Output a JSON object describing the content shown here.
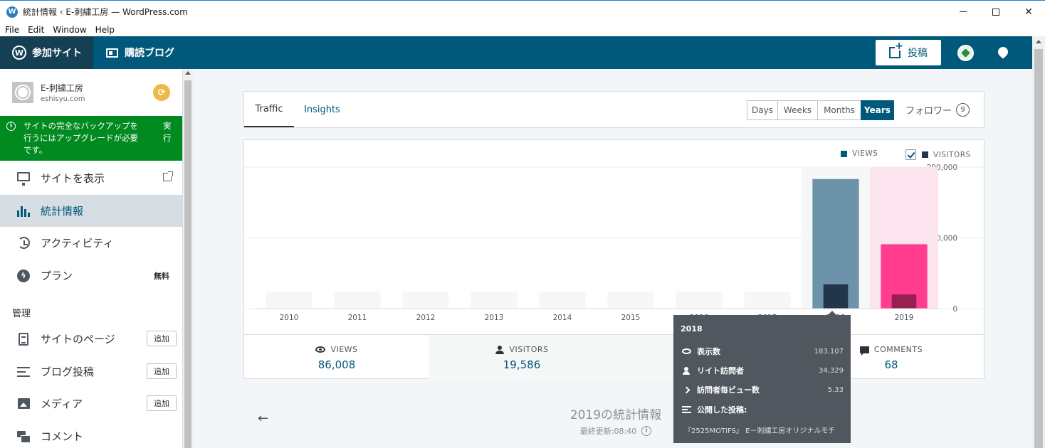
{
  "window": {
    "title": "統計情報 ‹ E-刺繍工房 — WordPress.com",
    "app_icon": "W"
  },
  "menubar": [
    "File",
    "Edit",
    "Window",
    "Help"
  ],
  "masterbar": {
    "my_sites": "参加サイト",
    "reader": "購読ブログ",
    "write": "投稿",
    "colors": {
      "bar": "#00587a",
      "active": "#154054"
    }
  },
  "site": {
    "name": "E-刺繍工房",
    "url": "eshisyu.com"
  },
  "notice": {
    "message": "サイトの完全なバックアップを行うにはアップグレードが必要です。",
    "action": "実行"
  },
  "sidebar": {
    "items": [
      {
        "label": "サイトを表示",
        "icon": "monitor-icon"
      },
      {
        "label": "統計情報",
        "icon": "stats-icon",
        "active": true
      },
      {
        "label": "アクティビティ",
        "icon": "history-icon"
      },
      {
        "label": "プラン",
        "icon": "plan-icon",
        "badge": "無料"
      }
    ],
    "group_heading": "管理",
    "manage_items": [
      {
        "label": "サイトのページ",
        "icon": "page-icon",
        "action": "追加"
      },
      {
        "label": "ブログ投稿",
        "icon": "posts-icon",
        "action": "追加"
      },
      {
        "label": "メディア",
        "icon": "media-icon",
        "action": "追加"
      },
      {
        "label": "コメント",
        "icon": "comment-icon"
      }
    ]
  },
  "stats": {
    "tabs": [
      "Traffic",
      "Insights"
    ],
    "periods": [
      "Days",
      "Weeks",
      "Months",
      "Years"
    ],
    "active_period": "Years",
    "followers_label": "フォロワー",
    "followers_count": "9",
    "legend": {
      "views": "VIEWS",
      "visitors": "VISITORS"
    },
    "summary": [
      {
        "label": "VIEWS",
        "value": "86,008",
        "icon": "eye-icon"
      },
      {
        "label": "VISITORS",
        "value": "19,586",
        "icon": "person-icon"
      },
      {
        "label": "COMMENTS",
        "value": "68",
        "icon": "comment-icon"
      }
    ],
    "period_title": "2019の統計情報",
    "last_updated": "最終更新:08:40"
  },
  "chart_data": {
    "type": "bar",
    "categories": [
      "2010",
      "2011",
      "2012",
      "2013",
      "2014",
      "2015",
      "2016",
      "2017",
      "2018",
      "2019"
    ],
    "series": [
      {
        "name": "VIEWS",
        "values": [
          0,
          0,
          0,
          0,
          0,
          0,
          0,
          0,
          183107,
          91000
        ]
      },
      {
        "name": "VISITORS",
        "values": [
          0,
          0,
          0,
          0,
          0,
          0,
          0,
          0,
          34329,
          20000
        ]
      }
    ],
    "y_ticks": [
      "0",
      "100,000",
      "200,000"
    ],
    "ylim": [
      0,
      200000
    ],
    "selected_category": "2019",
    "hovered_category": "2018",
    "colors": {
      "views": "#6d93ab",
      "visitors": "#23354b",
      "selected_views": "#ff3c8e",
      "selected_visitors": "#9a1f51",
      "selected_bg": "#fce4ee",
      "hover_bg": "#f6f7f7",
      "placeholder": "#f6f7f7"
    }
  },
  "tooltip": {
    "year": "2018",
    "rows": [
      {
        "label": "表示数",
        "value": "183,107"
      },
      {
        "label": "リイト訪問者",
        "value": "34,329"
      },
      {
        "label": "訪問者毎ビュー数",
        "value": "5.33"
      },
      {
        "label": "公開した投稿:",
        "value": ""
      }
    ],
    "post": "『2525MOTIFS』 E－刺繍工房オリジナルモチ"
  }
}
